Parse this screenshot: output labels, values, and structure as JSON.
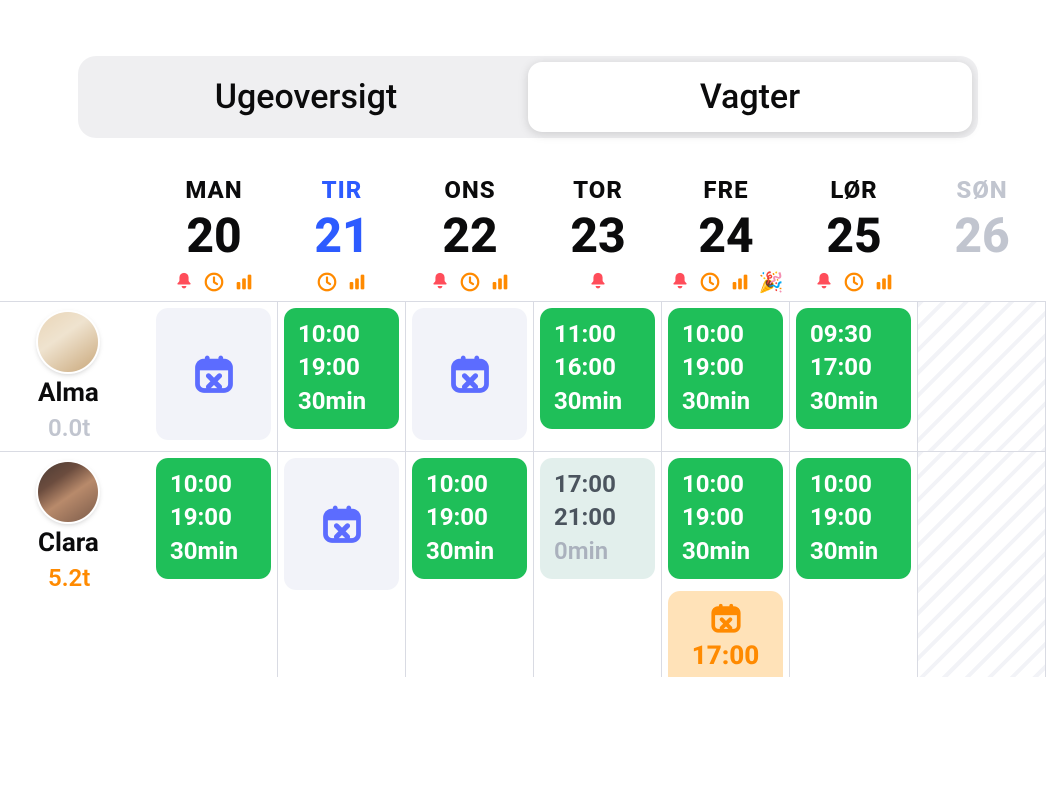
{
  "tabs": {
    "overview": "Ugeoversigt",
    "shifts": "Vagter"
  },
  "days": [
    {
      "abbr": "MAN",
      "num": "20",
      "state": "normal",
      "icons": [
        "bell",
        "clock",
        "bars"
      ]
    },
    {
      "abbr": "TIR",
      "num": "21",
      "state": "today",
      "icons": [
        "clock",
        "bars"
      ]
    },
    {
      "abbr": "ONS",
      "num": "22",
      "state": "normal",
      "icons": [
        "bell",
        "clock",
        "bars"
      ]
    },
    {
      "abbr": "TOR",
      "num": "23",
      "state": "normal",
      "icons": [
        "bell"
      ]
    },
    {
      "abbr": "FRE",
      "num": "24",
      "state": "normal",
      "icons": [
        "bell",
        "clock",
        "bars",
        "party"
      ]
    },
    {
      "abbr": "LØR",
      "num": "25",
      "state": "normal",
      "icons": [
        "bell",
        "clock",
        "bars"
      ]
    },
    {
      "abbr": "SØN",
      "num": "26",
      "state": "disabled",
      "icons": []
    }
  ],
  "employees": {
    "alma": {
      "name": "Alma",
      "hours": "0.0t",
      "hoursStyle": "gray"
    },
    "clara": {
      "name": "Clara",
      "hours": "5.2t",
      "hoursStyle": "orange"
    }
  },
  "cells": {
    "alma": [
      {
        "type": "placeholder"
      },
      {
        "type": "shift",
        "start": "10:00",
        "end": "19:00",
        "dur": "30min"
      },
      {
        "type": "placeholder"
      },
      {
        "type": "shift",
        "start": "11:00",
        "end": "16:00",
        "dur": "30min"
      },
      {
        "type": "shift",
        "start": "10:00",
        "end": "19:00",
        "dur": "30min"
      },
      {
        "type": "shift",
        "start": "09:30",
        "end": "17:00",
        "dur": "30min"
      },
      {
        "type": "sunday"
      }
    ],
    "clara": [
      {
        "type": "shift",
        "start": "10:00",
        "end": "19:00",
        "dur": "30min"
      },
      {
        "type": "placeholder"
      },
      {
        "type": "shift",
        "start": "10:00",
        "end": "19:00",
        "dur": "30min"
      },
      {
        "type": "light",
        "start": "17:00",
        "end": "21:00",
        "dur": "0min"
      },
      {
        "type": "shift",
        "start": "10:00",
        "end": "19:00",
        "dur": "30min",
        "timeoff": "17:00"
      },
      {
        "type": "shift",
        "start": "10:00",
        "end": "19:00",
        "dur": "30min"
      },
      {
        "type": "sunday"
      }
    ]
  }
}
